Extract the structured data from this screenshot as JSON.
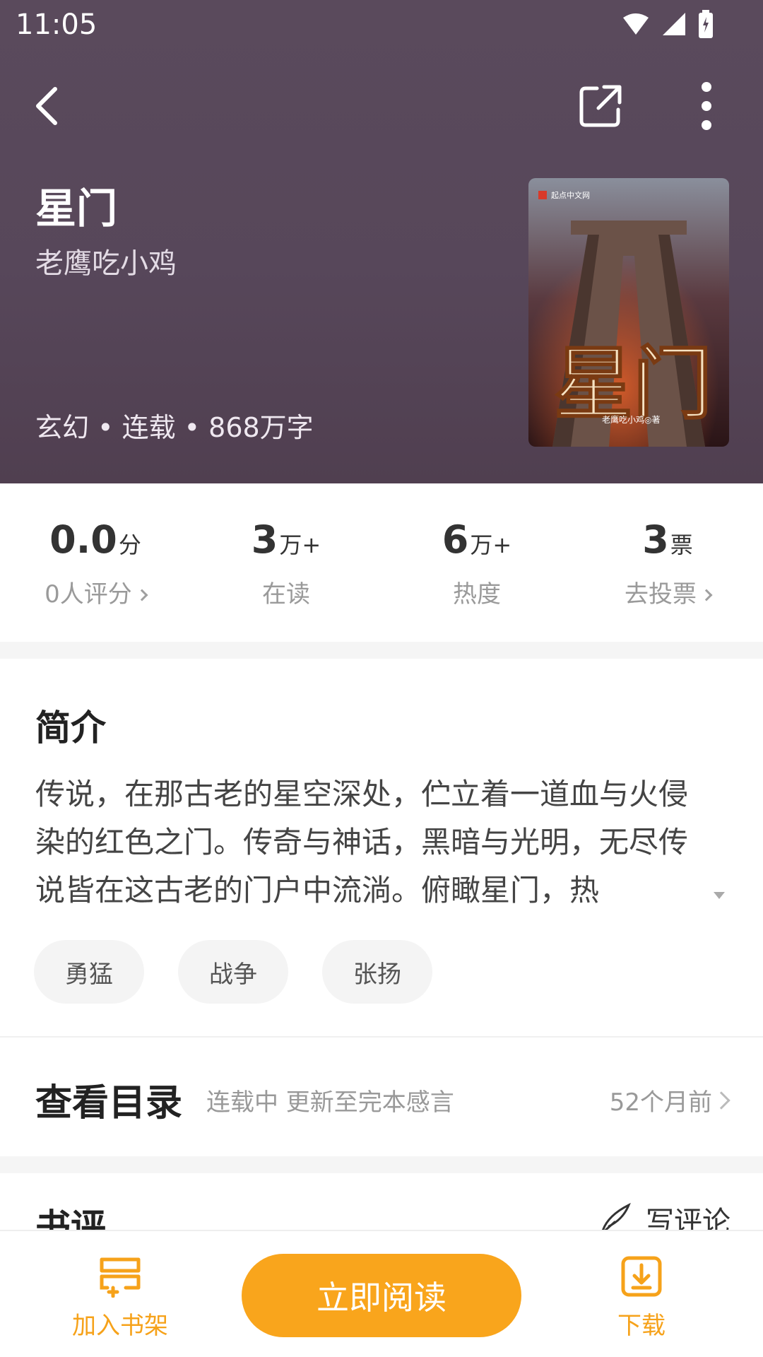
{
  "status_bar": {
    "time": "11:05"
  },
  "book": {
    "title": "星门",
    "author": "老鹰吃小鸡",
    "meta": "玄幻 • 连载 • 868万字",
    "cover_title_art": "星门",
    "cover_publisher": "起点中文网",
    "cover_author": "老鹰吃小鸡◎著"
  },
  "stats": [
    {
      "value": "0.0",
      "unit": "分",
      "label": "0人评分"
    },
    {
      "value": "3",
      "unit": "万+",
      "label": "在读"
    },
    {
      "value": "6",
      "unit": "万+",
      "label": "热度"
    },
    {
      "value": "3",
      "unit": "票",
      "label": "去投票"
    }
  ],
  "intro": {
    "title": "简介",
    "text": "传说，在那古老的星空深处，伫立着一道血与火侵染的红色之门。传奇与神话，黑暗与光明，无尽传说皆在这古老的门户中流淌。俯瞰星门，热"
  },
  "tags": [
    "勇猛",
    "战争",
    "张扬"
  ],
  "catalog": {
    "title": "查看目录",
    "status": "连载中 更新至完本感言",
    "updated": "52个月前"
  },
  "reviews": {
    "title": "书评",
    "write_label": "写评论"
  },
  "bottom_bar": {
    "shelf_label": "加入书架",
    "read_label": "立即阅读",
    "download_label": "下载"
  },
  "colors": {
    "accent": "#f9a51c",
    "hero_bg": "#57475a"
  },
  "icons": [
    "back-icon",
    "share-icon",
    "more-icon",
    "wifi-icon",
    "signal-icon",
    "battery-icon",
    "bookshelf-icon",
    "download-icon",
    "pen-icon"
  ]
}
